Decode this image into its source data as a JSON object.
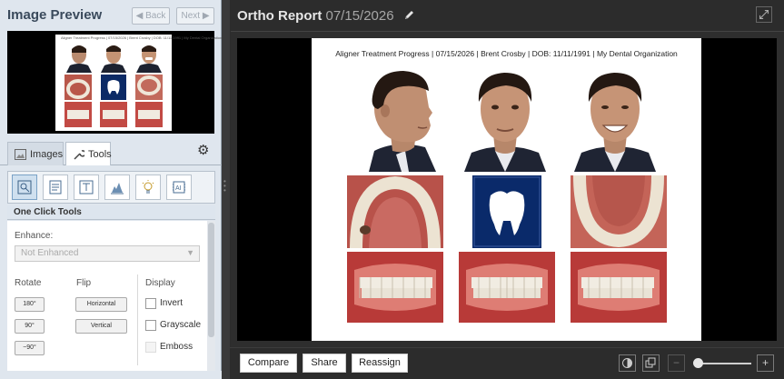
{
  "left_panel": {
    "title": "Image Preview",
    "back_label": "◀ Back",
    "next_label": "Next ▶",
    "thumbnail_caption": "Aligner Treatment Progress | 07/15/2026 | Brent Crosby | DOB: 11/11/1991 | My Dental Organization",
    "tabs": {
      "images": "Images",
      "tools": "Tools"
    },
    "section_title": "One Click Tools",
    "enhance_label": "Enhance:",
    "enhance_value": "Not Enhanced",
    "rotate_label": "Rotate",
    "rotate_buttons": [
      "180°",
      "90°",
      "−90°"
    ],
    "flip_label": "Flip",
    "flip_buttons": [
      "Horizontal",
      "Vertical"
    ],
    "display_label": "Display",
    "display_options": [
      "Invert",
      "Grayscale",
      "Emboss"
    ]
  },
  "right_panel": {
    "title": "Ortho Report",
    "date": "07/15/2026",
    "report_caption": "Aligner Treatment Progress | 07/15/2026 | Brent Crosby | DOB: 11/11/1991 | My Dental Organization",
    "buttons": {
      "compare": "Compare",
      "share": "Share",
      "reassign": "Reassign"
    }
  },
  "colors": {
    "accent": "#7aa2c6",
    "panel_bg": "#dfe6ee",
    "dark_bg": "#2c2c2c"
  },
  "icons": [
    "pencil-icon",
    "expand-icon",
    "gear-icon",
    "images-icon",
    "wrench-icon",
    "zoom-tool-icon",
    "notes-tool-icon",
    "text-tool-icon",
    "histogram-tool-icon",
    "lightbulb-tool-icon",
    "ai-tool-icon",
    "contrast-icon",
    "duplicate-icon",
    "minus-icon",
    "plus-icon"
  ]
}
